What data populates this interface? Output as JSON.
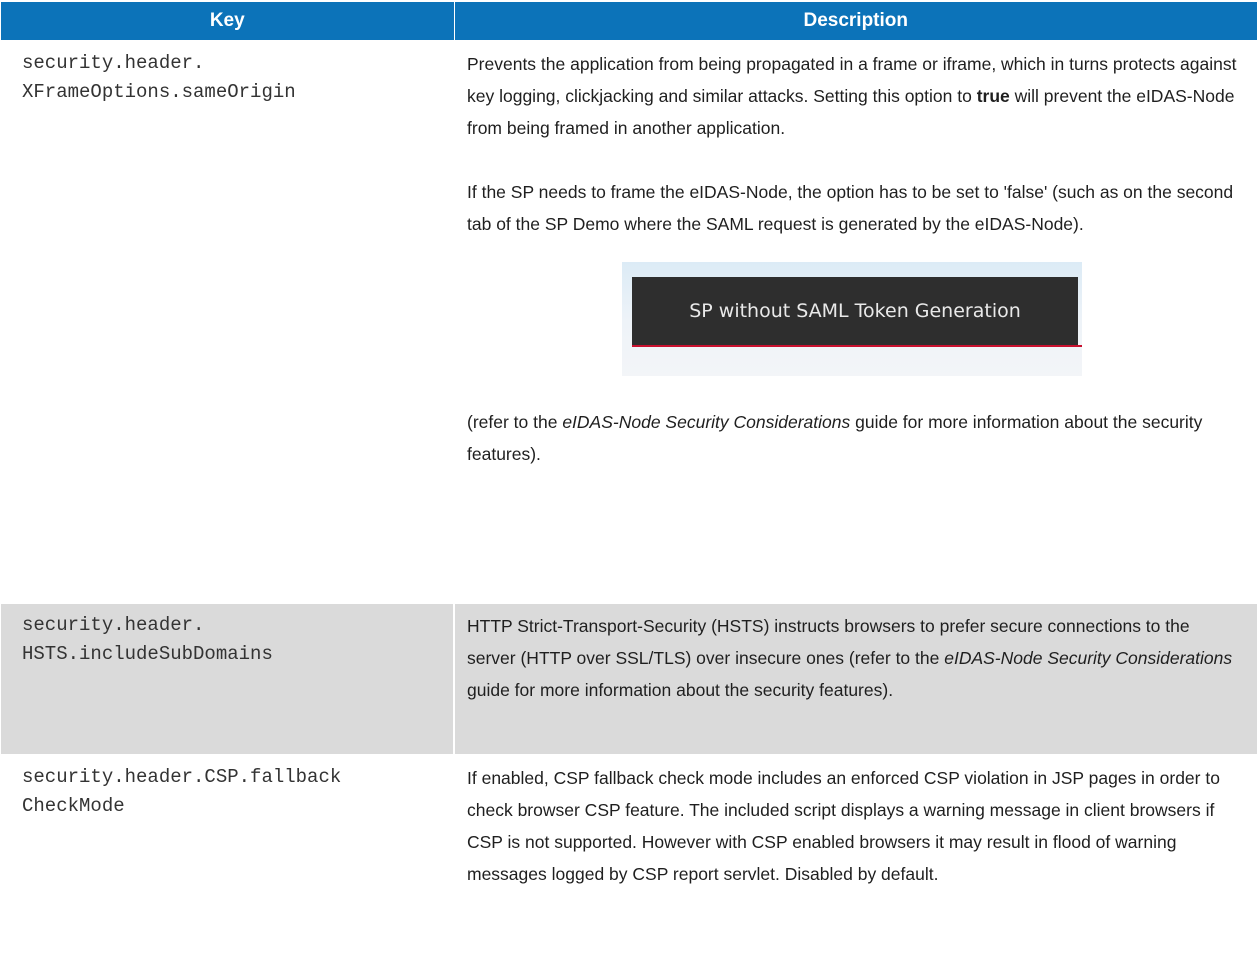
{
  "header": {
    "key_label": "Key",
    "description_label": "Description"
  },
  "rows": [
    {
      "key_lines": [
        "security.header.",
        "XFrameOptions.sameOrigin"
      ],
      "p1_a": "Prevents the application from being propagated in a frame or iframe, which in turns protects against key logging, clickjacking and similar attacks. Setting this option to ",
      "p1_bold": "true",
      "p1_b": " will prevent the eIDAS-Node from being framed in another application.",
      "p2": "If the SP needs to frame the eIDAS-Node, the option has to be set to 'false' (such as on the second tab of the SP Demo where the SAML request is generated by the eIDAS-Node).",
      "image_tab_label": "SP without SAML Token Generation",
      "p3_a": "(refer to the ",
      "p3_italic": "eIDAS-Node Security Considerations",
      "p3_b": " guide for more information about the security features)."
    },
    {
      "key_lines": [
        "security.header.",
        "HSTS.includeSubDomains"
      ],
      "p1_a": "HTTP Strict-Transport-Security (HSTS) instructs browsers to prefer secure connections to the server (HTTP over SSL/TLS) over insecure ones (refer to the ",
      "p1_italic": "eIDAS-Node Security Considerations",
      "p1_b": " guide for more information about the security features)."
    },
    {
      "key_lines": [
        "security.header.CSP.fallback",
        "CheckMode"
      ],
      "p1": "If enabled, CSP fallback check mode includes an enforced CSP violation in JSP pages in order to check browser CSP feature. The included script displays a warning message in client browsers if CSP is not supported. However with CSP enabled browsers it may result in flood of warning messages logged by CSP report servlet. Disabled by default."
    }
  ],
  "colors": {
    "header_bg": "#0c73b9",
    "header_text": "#ffffff",
    "alt_row_bg": "#dadada",
    "tab_underline": "#c8102e",
    "tab_bg": "#2e2e2e"
  }
}
